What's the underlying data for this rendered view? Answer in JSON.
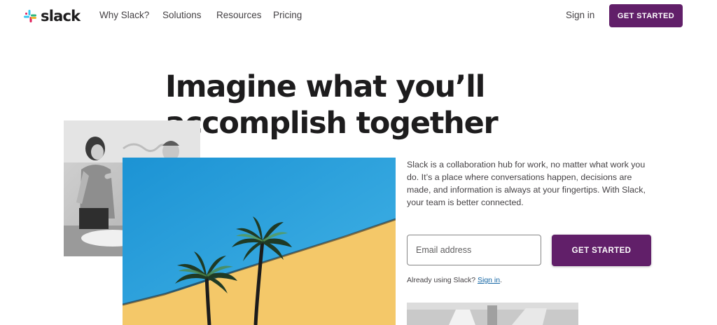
{
  "header": {
    "logo_text": "slack",
    "nav": [
      "Why Slack?",
      "Solutions",
      "Resources",
      "Pricing"
    ],
    "signin_label": "Sign in",
    "cta_label": "GET STARTED"
  },
  "hero": {
    "headline_line1": "Imagine what you’ll",
    "headline_line2": "accomplish together",
    "description": "Slack is a collaboration hub for work, no matter what work you do. It’s a place where conversations happen, decisions are made, and information is always at your fingertips. With Slack, your team is better connected.",
    "email_placeholder": "Email address",
    "cta_label": "GET STARTED",
    "already_text": "Already using Slack?",
    "signin_link": "Sign in",
    "signin_suffix": "."
  },
  "colors": {
    "brand_purple": "#611f69",
    "text_dark": "#1d1c1d",
    "link_blue": "#1264a3",
    "sky_blue": "#2aa3df",
    "wall_yellow": "#f4c869"
  },
  "icons": [
    "slack-logo-icon"
  ]
}
